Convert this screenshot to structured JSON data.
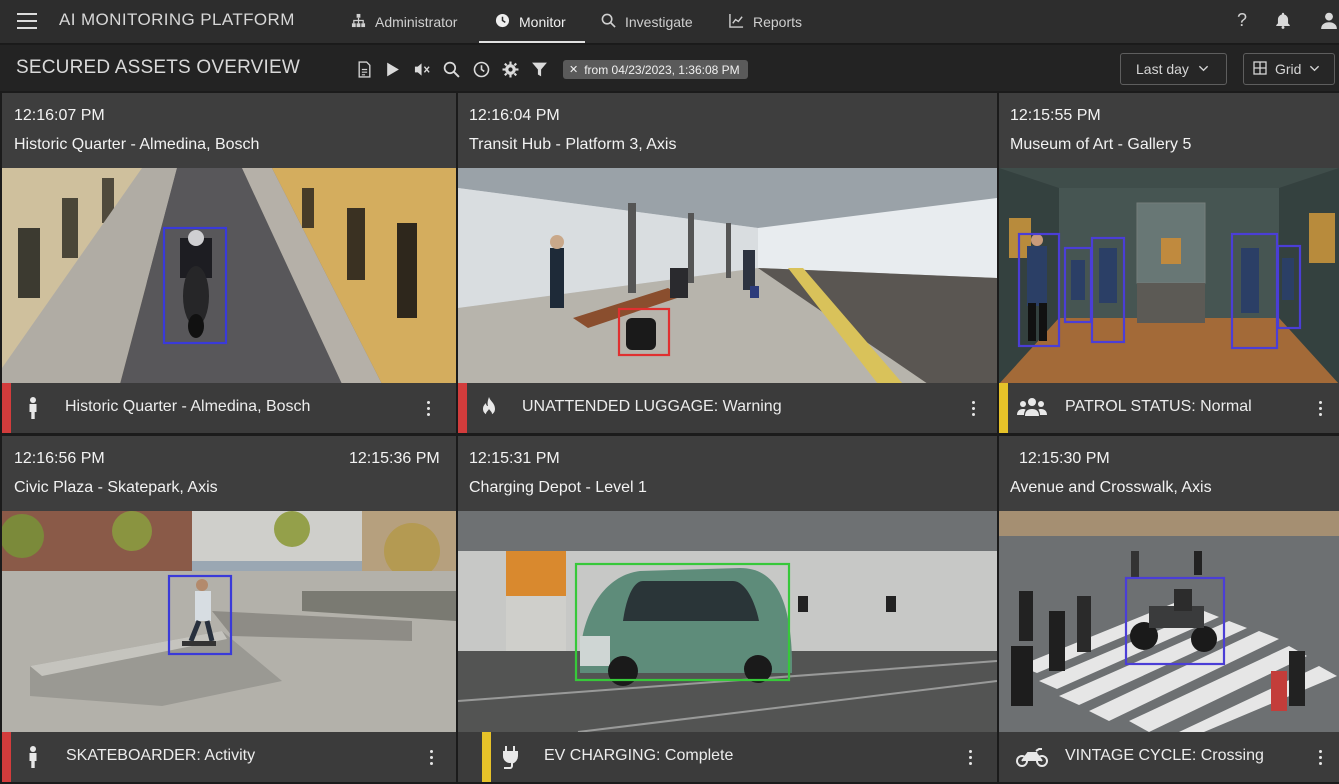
{
  "app": {
    "title": "AI MONITORING PLATFORM"
  },
  "nav": [
    {
      "label": "Administrator",
      "icon": "sitemap-icon"
    },
    {
      "label": "Monitor",
      "icon": "clock-icon",
      "active": true
    },
    {
      "label": "Investigate",
      "icon": "search-icon"
    },
    {
      "label": "Reports",
      "icon": "chart-icon"
    }
  ],
  "toolbar": {
    "title": "SECURED ASSETS OVERVIEW",
    "filter_chip": "from 04/23/2023, 1:36:08 PM",
    "range_select": "Last day",
    "view_select": "Grid"
  },
  "colors": {
    "severity_red": "#d23c3c",
    "severity_yellow": "#e6c229",
    "box_blue": "#3a3ad9",
    "box_red": "#e03030",
    "box_green": "#37c83a"
  },
  "tiles": [
    {
      "time": "12:16:07 PM",
      "name": "Historic Quarter - Almedina, Bosch",
      "event": "Historic Quarter - Almedina, Bosch",
      "icon": "person-icon",
      "severity": "red"
    },
    {
      "time": "12:16:04 PM",
      "name": "Transit Hub - Platform 3, Axis",
      "event": "UNATTENDED LUGGAGE: Warning",
      "icon": "flame-icon",
      "severity": "red"
    },
    {
      "time": "12:15:55 PM",
      "name": "Museum of Art - Gallery 5",
      "event": "PATROL STATUS: Normal",
      "icon": "group-icon",
      "severity": "yellow"
    },
    {
      "time": "12:16:56 PM",
      "time_right": "12:15:36 PM",
      "name": "Civic Plaza - Skatepark, Axis",
      "event": "SKATEBOARDER: Activity",
      "icon": "person-icon",
      "severity": "red"
    },
    {
      "time": "12:15:31 PM",
      "name": "Charging Depot - Level 1",
      "event": "EV CHARGING: Complete",
      "icon": "plug-icon",
      "severity": "yellow"
    },
    {
      "time": "12:15:30 PM",
      "name": "Avenue and Crosswalk, Axis",
      "event": "VINTAGE CYCLE: Crossing",
      "icon": "motorcycle-icon",
      "severity": "none"
    }
  ]
}
